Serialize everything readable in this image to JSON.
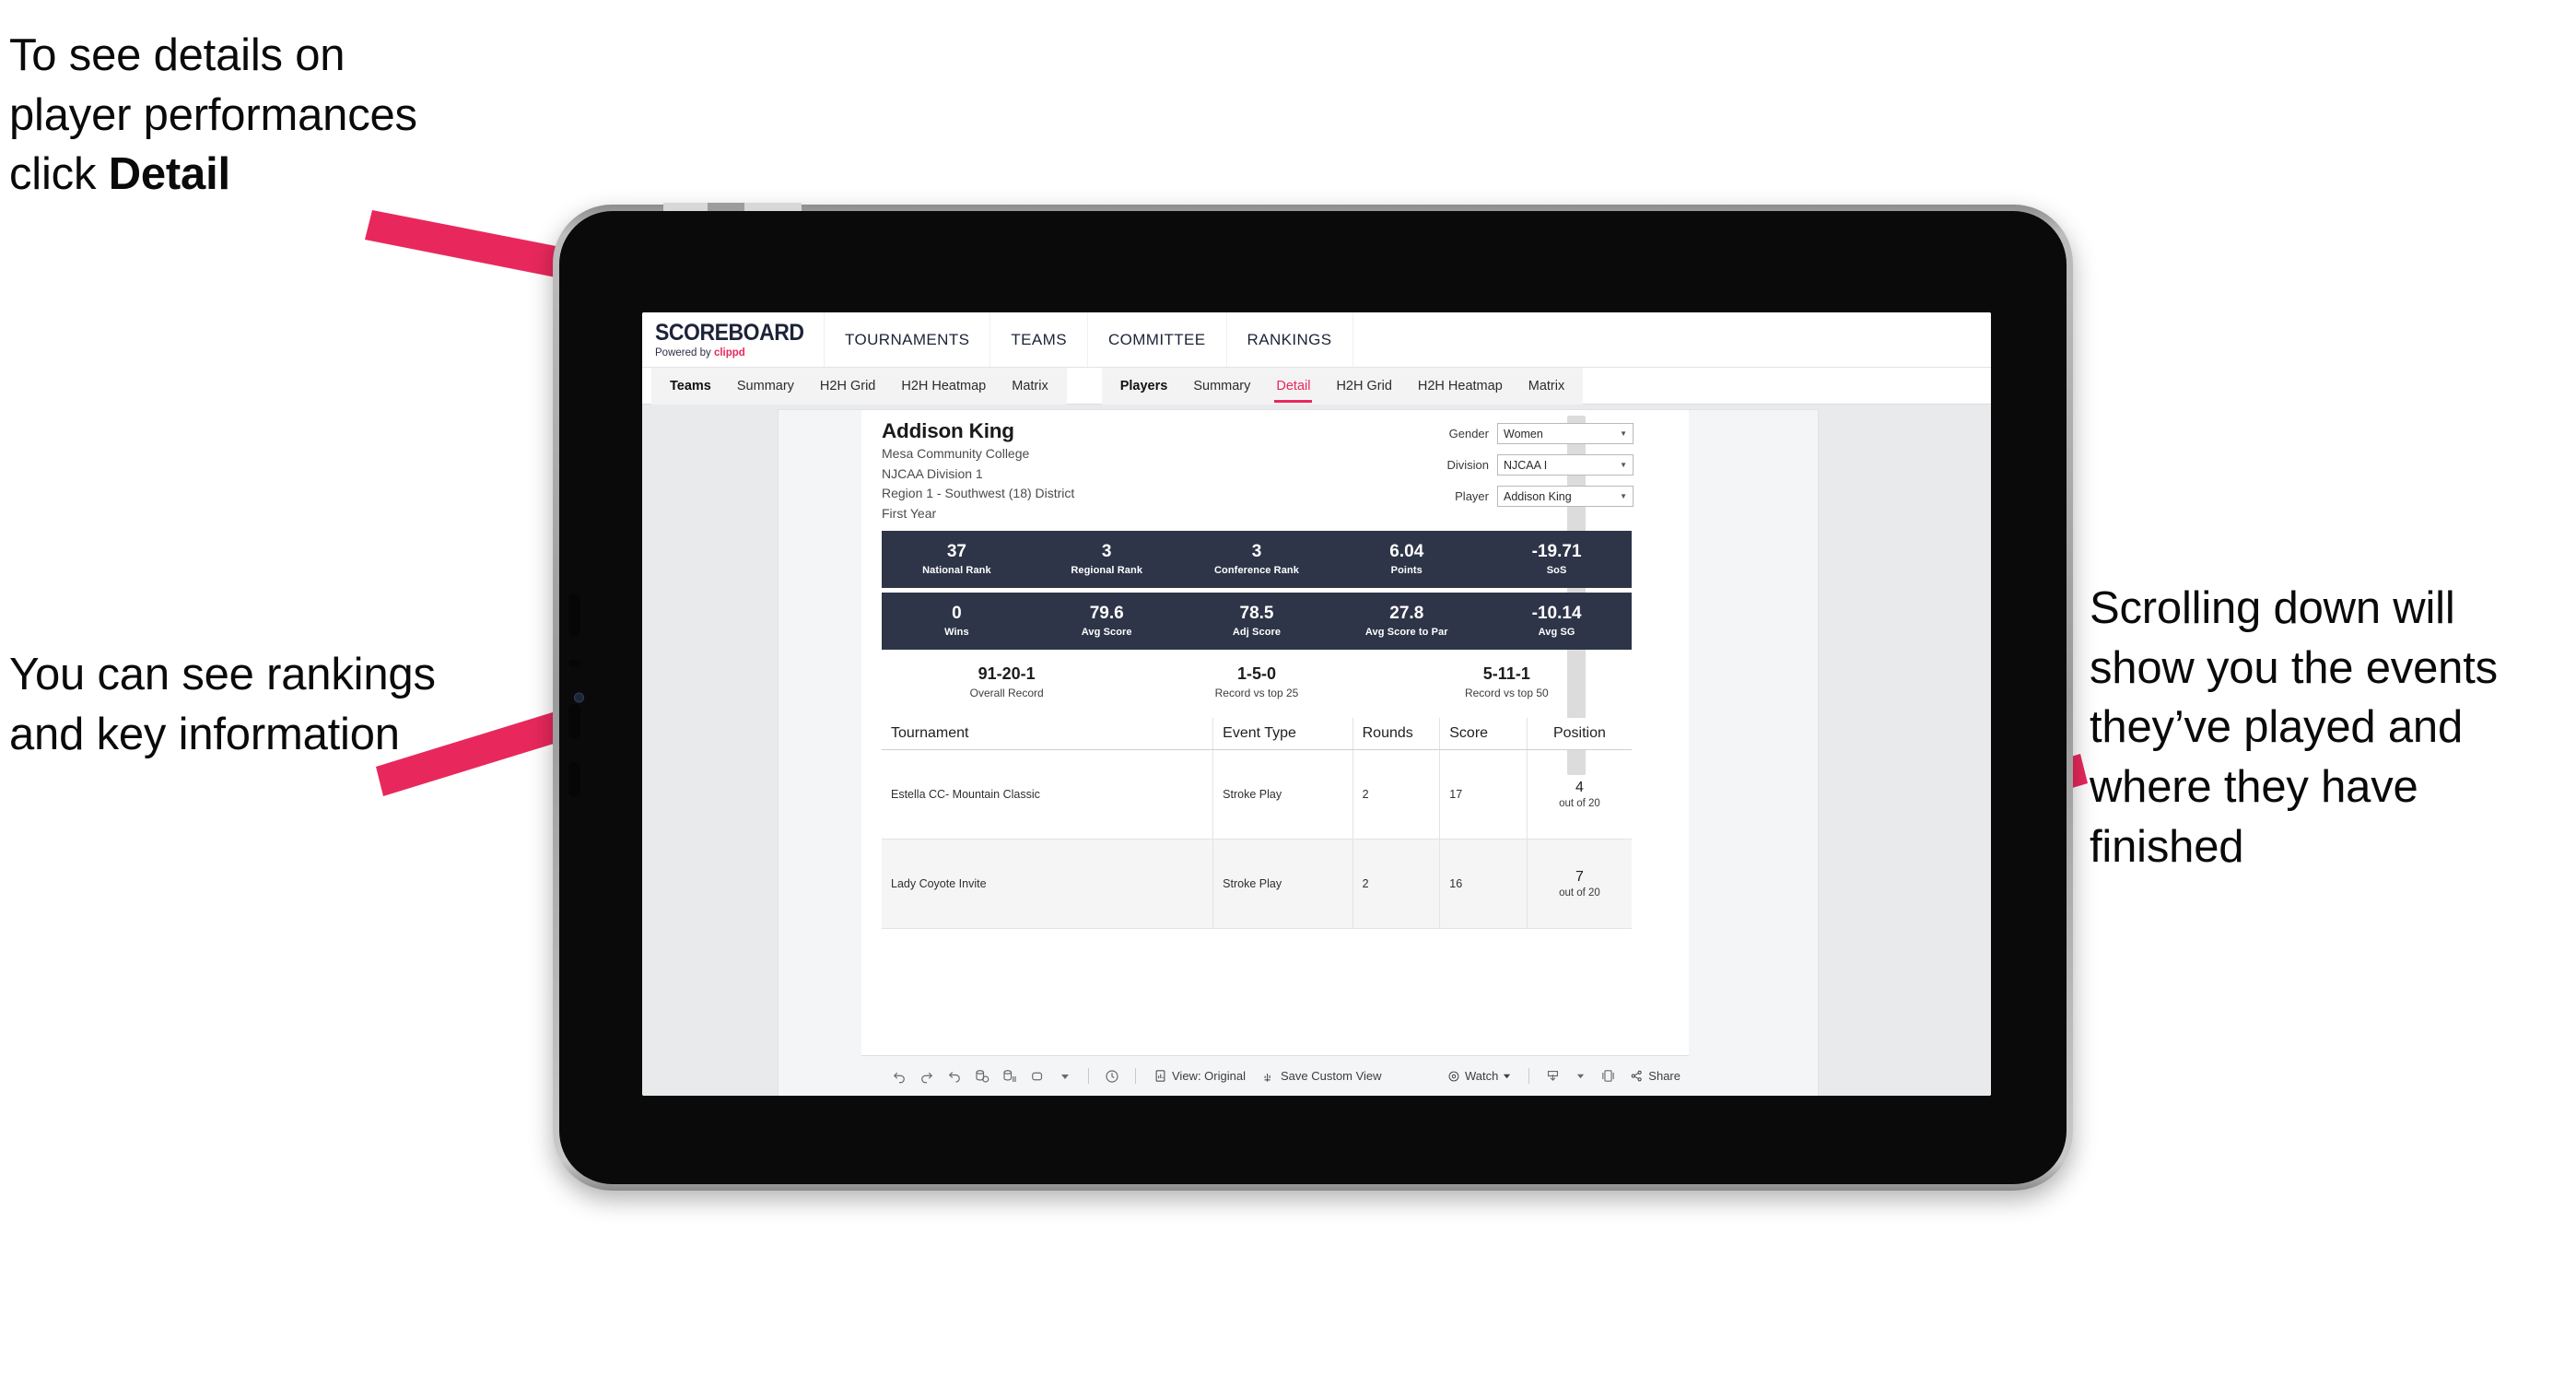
{
  "annotations": {
    "top_left": {
      "line1": "To see details on",
      "line2": "player performances",
      "line3_prefix": "click ",
      "line3_bold": "Detail"
    },
    "mid_left": "You can see rankings and key information",
    "right": "Scrolling down will show you the events they’ve played and where they have finished"
  },
  "accent": {
    "pink": "#e8285c",
    "navy": "#2e3548"
  },
  "app": {
    "brand": {
      "title": "SCOREBOARD",
      "powered_prefix": "Powered by ",
      "powered_brand": "clippd"
    },
    "topnav": [
      "TOURNAMENTS",
      "TEAMS",
      "COMMITTEE",
      "RANKINGS"
    ],
    "subnav_teams": [
      "Teams",
      "Summary",
      "H2H Grid",
      "H2H Heatmap",
      "Matrix"
    ],
    "subnav_players": [
      "Players",
      "Summary",
      "Detail",
      "H2H Grid",
      "H2H Heatmap",
      "Matrix"
    ],
    "subnav_active": "Detail"
  },
  "player": {
    "name": "Addison King",
    "school": "Mesa Community College",
    "division": "NJCAA Division 1",
    "region": "Region 1 - Southwest (18) District",
    "year": "First Year"
  },
  "filters": [
    {
      "label": "Gender",
      "value": "Women"
    },
    {
      "label": "Division",
      "value": "NJCAA I"
    },
    {
      "label": "Player",
      "value": "Addison King"
    }
  ],
  "stats_row1": [
    {
      "value": "37",
      "label": "National Rank"
    },
    {
      "value": "3",
      "label": "Regional Rank"
    },
    {
      "value": "3",
      "label": "Conference Rank"
    },
    {
      "value": "6.04",
      "label": "Points"
    },
    {
      "value": "-19.71",
      "label": "SoS"
    }
  ],
  "stats_row2": [
    {
      "value": "0",
      "label": "Wins"
    },
    {
      "value": "79.6",
      "label": "Avg Score"
    },
    {
      "value": "78.5",
      "label": "Adj Score"
    },
    {
      "value": "27.8",
      "label": "Avg Score to Par"
    },
    {
      "value": "-10.14",
      "label": "Avg SG"
    }
  ],
  "records": [
    {
      "value": "91-20-1",
      "label": "Overall Record"
    },
    {
      "value": "1-5-0",
      "label": "Record vs top 25"
    },
    {
      "value": "5-11-1",
      "label": "Record vs top 50"
    }
  ],
  "table": {
    "columns": [
      "Tournament",
      "Event Type",
      "Rounds",
      "Score",
      "Position"
    ],
    "rows": [
      {
        "tournament": "Estella CC- Mountain Classic",
        "event_type": "Stroke Play",
        "rounds": "2",
        "score": "17",
        "position": "4",
        "position_sub": "out of 20"
      },
      {
        "tournament": "Lady Coyote Invite",
        "event_type": "Stroke Play",
        "rounds": "2",
        "score": "16",
        "position": "7",
        "position_sub": "out of 20"
      }
    ]
  },
  "toolbar": {
    "view_label": "View: Original",
    "save_label": "Save Custom View",
    "watch_label": "Watch",
    "share_label": "Share"
  }
}
